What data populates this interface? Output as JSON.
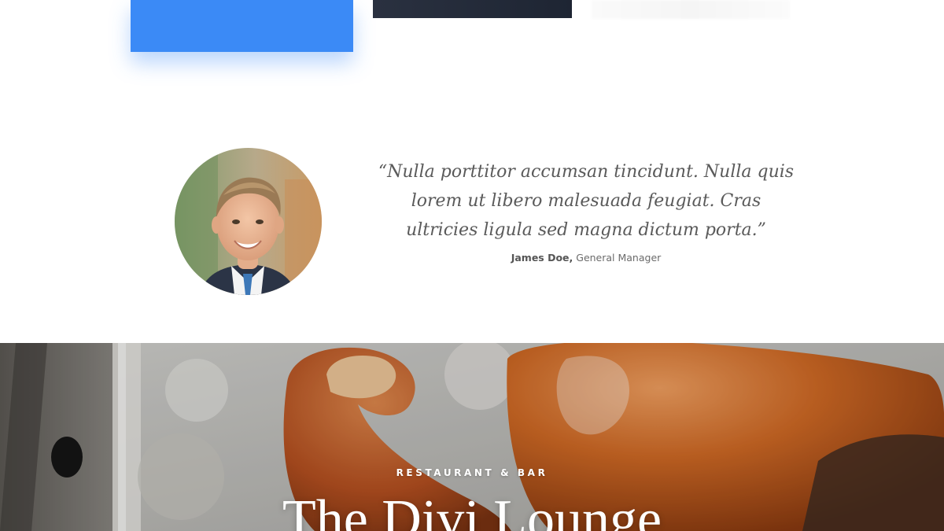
{
  "testimonial": {
    "quote": "“Nulla porttitor accumsan tincidunt. Nulla quis lorem ut libero malesuada feugiat. Cras ultricies ligula sed magna dictum porta.”",
    "author_name": "James Doe,",
    "author_role": " General Manager"
  },
  "hero": {
    "eyebrow": "RESTAURANT & BAR",
    "title": "The Divi Lounge"
  },
  "colors": {
    "accent_blue": "#3b8af6",
    "dark_card": "#222a38",
    "crab_orange": "#c8561b"
  },
  "icons": {
    "avatar": "portrait-photo",
    "hero_background": "crab-photo"
  }
}
